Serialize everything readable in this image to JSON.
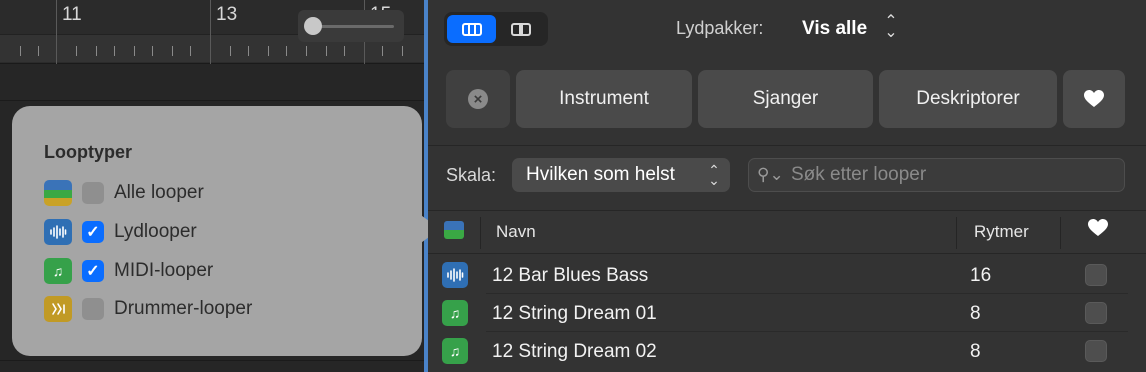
{
  "timeline": {
    "bar_numbers": [
      "11",
      "13",
      "15"
    ]
  },
  "loop_types": {
    "title": "Looptyper",
    "items": [
      {
        "label": "Alle looper",
        "icon": "all-loops-icon",
        "checked": false
      },
      {
        "label": "Lydlooper",
        "icon": "audio-waveform-icon",
        "checked": true
      },
      {
        "label": "MIDI-looper",
        "icon": "music-note-icon",
        "checked": true
      },
      {
        "label": "Drummer-looper",
        "icon": "drummer-icon",
        "checked": false
      }
    ]
  },
  "browser": {
    "view_buttons": [
      "button-view-icon",
      "column-view-icon"
    ],
    "packs_label": "Lydpakker:",
    "packs_value": "Vis alle",
    "filters": {
      "instrument": "Instrument",
      "genre": "Sjanger",
      "descriptors": "Deskriptorer"
    },
    "scale_label": "Skala:",
    "scale_value": "Hvilken som helst",
    "search_placeholder": "Søk etter looper",
    "columns": {
      "name": "Navn",
      "beats": "Rytmer"
    },
    "rows": [
      {
        "name": "12 Bar Blues Bass",
        "beats": "16",
        "type": "audio"
      },
      {
        "name": "12 String Dream 01",
        "beats": "8",
        "type": "midi"
      },
      {
        "name": "12 String Dream 02",
        "beats": "8",
        "type": "midi"
      }
    ]
  },
  "colors": {
    "accent": "#0a6dff",
    "audio_loop": "#2f6fb4",
    "midi_loop": "#36a14a",
    "drummer_loop": "#c19a25"
  }
}
